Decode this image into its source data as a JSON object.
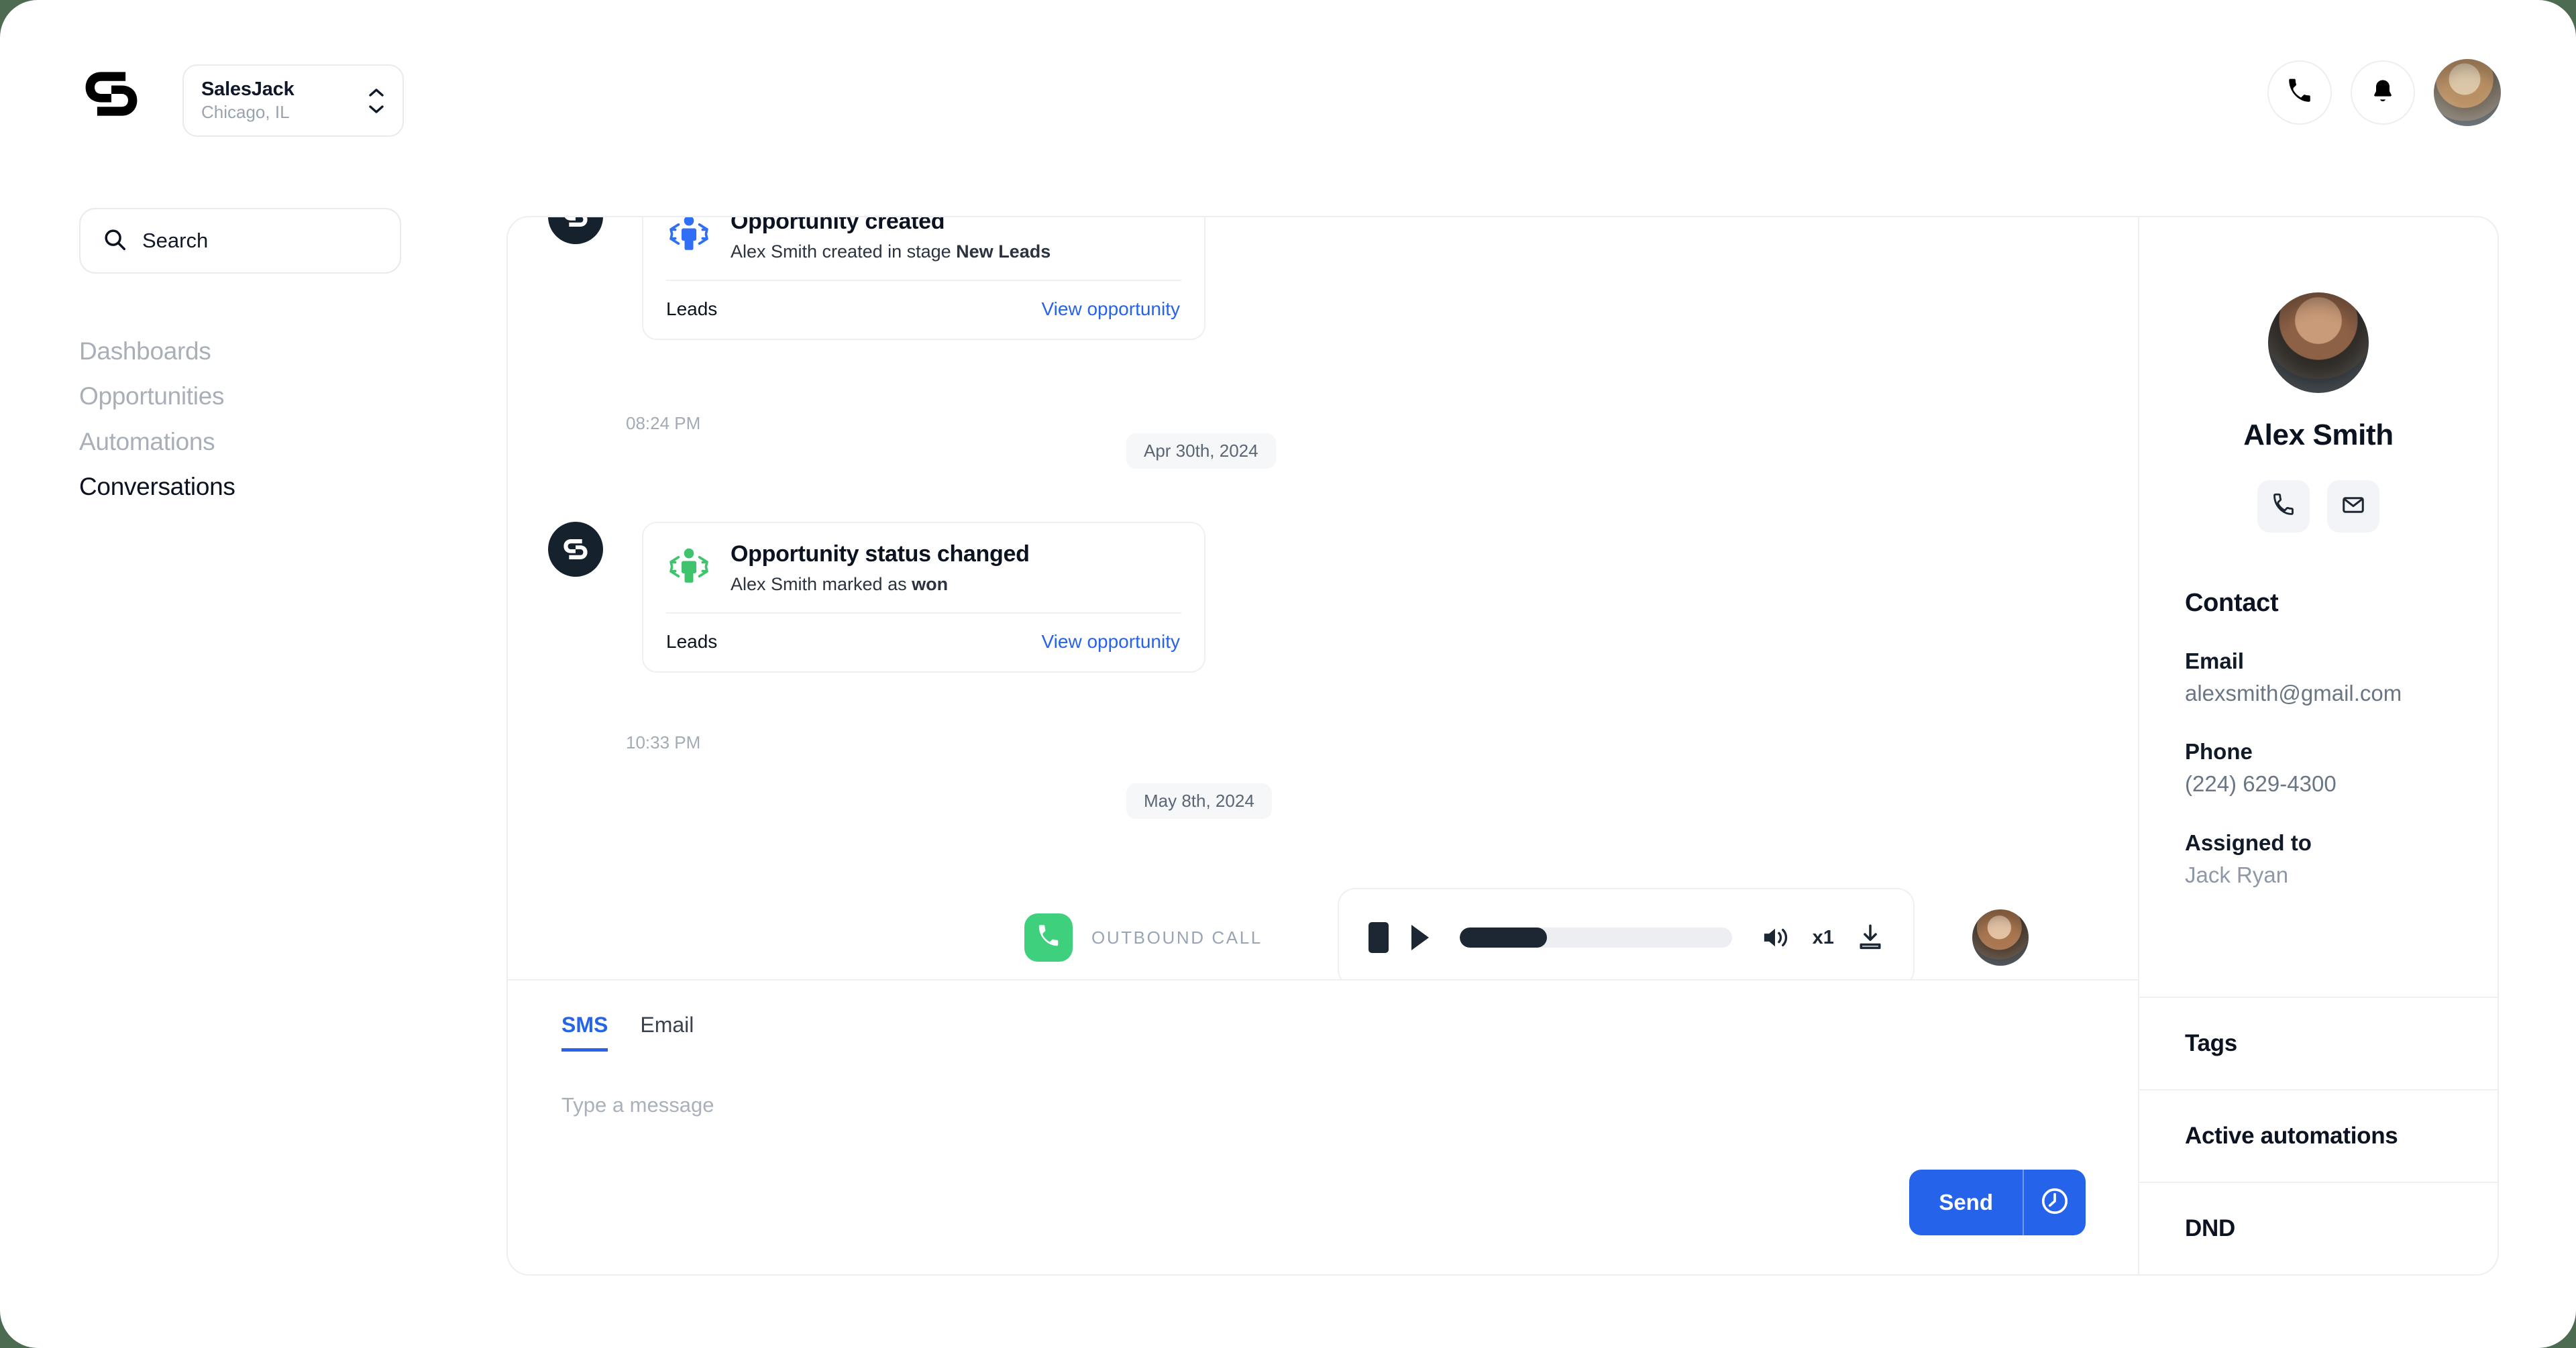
{
  "header": {
    "logo_icon": "salesjack-logo-icon",
    "workspace": {
      "name": "SalesJack",
      "location": "Chicago, IL"
    },
    "actions": {
      "phone": "phone-icon",
      "notifications": "bell-icon",
      "avatar": "user-avatar"
    }
  },
  "sidebar": {
    "search": {
      "placeholder": "Search",
      "icon": "search-icon"
    },
    "items": [
      {
        "label": "Dashboards",
        "active": false
      },
      {
        "label": "Opportunities",
        "active": false
      },
      {
        "label": "Automations",
        "active": false
      },
      {
        "label": "Conversations",
        "active": true
      }
    ]
  },
  "thread": {
    "events": [
      {
        "title": "Opportunity created",
        "subject": "Alex Smith",
        "subtext_before": "Alex Smith created in stage ",
        "subtext_bold": "New Leads",
        "pipeline": "Leads",
        "link": "View opportunity",
        "time": "08:24 PM",
        "icon": "opportunity-created-icon",
        "icon_color": "#2f6ef5"
      },
      {
        "title": "Opportunity status changed",
        "subtext_before": "Alex Smith marked as ",
        "subtext_bold": "won",
        "pipeline": "Leads",
        "link": "View opportunity",
        "time": "10:33 PM",
        "icon": "opportunity-status-icon",
        "icon_color": "#3fc46d"
      }
    ],
    "date_separators": [
      "Apr 30th, 2024",
      "May 8th, 2024"
    ],
    "call": {
      "label": "OUTBOUND CALL",
      "badge_icon": "phone-icon",
      "badge_color": "#3fd07d",
      "player": {
        "stop_icon": "stop-icon",
        "play_icon": "play-icon",
        "progress_percent": 32,
        "volume_icon": "volume-icon",
        "speed": "x1",
        "download_icon": "download-icon"
      },
      "agent_avatar": "agent-avatar"
    }
  },
  "composer": {
    "tabs": [
      {
        "label": "SMS",
        "active": true
      },
      {
        "label": "Email",
        "active": false
      }
    ],
    "input_placeholder": "Type a message",
    "input_value": "",
    "send_label": "Send",
    "schedule_icon": "clock-icon"
  },
  "contact": {
    "avatar": "contact-avatar",
    "name": "Alex Smith",
    "quick_actions": [
      {
        "icon": "phone-icon",
        "name": "call"
      },
      {
        "icon": "mail-icon",
        "name": "email"
      }
    ],
    "section_title": "Contact",
    "fields": [
      {
        "label": "Email",
        "value": "alexsmith@gmail.com"
      },
      {
        "label": "Phone",
        "value": "(224) 629-4300"
      },
      {
        "label": "Assigned to",
        "value": "Jack Ryan"
      }
    ],
    "rows": [
      {
        "label": "Tags"
      },
      {
        "label": "Active automations"
      },
      {
        "label": "DND"
      }
    ]
  },
  "colors": {
    "page_background": "#4c6b51",
    "accent_blue": "#2563eb",
    "accent_green": "#3fd07d",
    "dark": "#16212e"
  }
}
